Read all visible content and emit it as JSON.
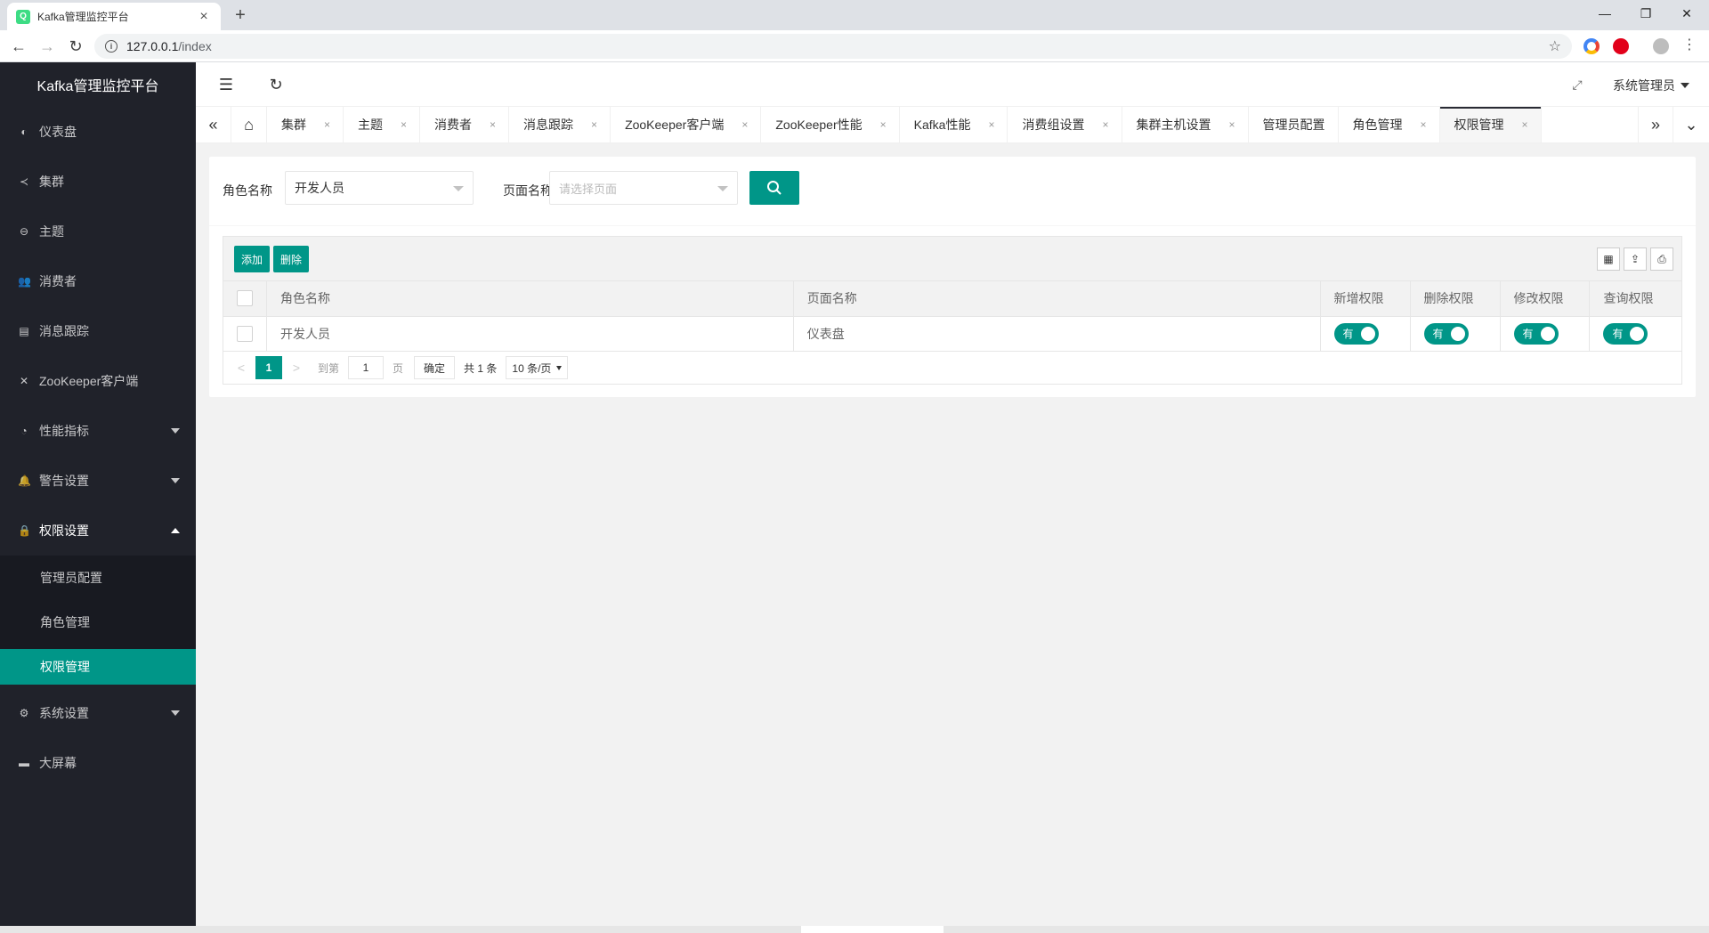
{
  "browser": {
    "tab_title": "Kafka管理监控平台",
    "tab_close": "×",
    "newtab": "+",
    "favicon": "Q",
    "url_host": "127.0.0.1",
    "url_path": "/index",
    "back": "←",
    "forward": "→",
    "reload": "↻",
    "star": "☆",
    "minimize": "—",
    "maximize": "❐",
    "close": "✕"
  },
  "sidebar": {
    "logo": "Kafka管理监控平台",
    "items": [
      {
        "label": "仪表盘",
        "icon": "dashboard-icon",
        "glyph": "◐"
      },
      {
        "label": "集群",
        "icon": "share-icon",
        "glyph": "≺"
      },
      {
        "label": "主题",
        "icon": "topic-icon",
        "glyph": "⊖"
      },
      {
        "label": "消费者",
        "icon": "users-icon",
        "glyph": "👥"
      },
      {
        "label": "消息跟踪",
        "icon": "document-icon",
        "glyph": "▤"
      },
      {
        "label": "ZooKeeper客户端",
        "icon": "tools-icon",
        "glyph": "✕"
      },
      {
        "label": "性能指标",
        "icon": "gauge-icon",
        "glyph": "◔"
      },
      {
        "label": "警告设置",
        "icon": "bell-icon",
        "glyph": "🔔"
      },
      {
        "label": "权限设置",
        "icon": "lock-icon",
        "glyph": "🔒"
      },
      {
        "label": "系统设置",
        "icon": "gear-icon",
        "glyph": "⚙"
      },
      {
        "label": "大屏幕",
        "icon": "monitor-icon",
        "glyph": "▬"
      }
    ],
    "subitems": [
      {
        "label": "管理员配置"
      },
      {
        "label": "角色管理"
      },
      {
        "label": "权限管理"
      }
    ]
  },
  "header": {
    "menu_icon": "☰",
    "refresh_icon": "↻",
    "fullscreen_icon": "⤢",
    "user": "系统管理员"
  },
  "pagetabs": {
    "left_arrow": "«",
    "home": "⌂",
    "right_arrow": "»",
    "down_arrow": "⌄",
    "close": "×",
    "tabs": [
      {
        "label": "集群"
      },
      {
        "label": "主题"
      },
      {
        "label": "消费者"
      },
      {
        "label": "消息跟踪"
      },
      {
        "label": "ZooKeeper客户端"
      },
      {
        "label": "ZooKeeper性能"
      },
      {
        "label": "Kafka性能"
      },
      {
        "label": "消费组设置"
      },
      {
        "label": "集群主机设置"
      },
      {
        "label": "管理员配置"
      },
      {
        "label": "角色管理"
      },
      {
        "label": "权限管理"
      }
    ]
  },
  "search": {
    "role_label": "角色名称",
    "role_value": "开发人员",
    "page_label": "页面名称",
    "page_placeholder": "请选择页面"
  },
  "table": {
    "add_button": "添加",
    "delete_button": "删除",
    "tool_cols": "▦",
    "tool_export": "⇪",
    "tool_print": "⎙",
    "headers": [
      "角色名称",
      "页面名称",
      "新增权限",
      "删除权限",
      "修改权限",
      "查询权限"
    ],
    "rows": [
      {
        "role": "开发人员",
        "page": "仪表盘",
        "add": "有",
        "del": "有",
        "edit": "有",
        "query": "有"
      }
    ]
  },
  "pager": {
    "prev": "<",
    "current": "1",
    "next": ">",
    "goto_label": "到第",
    "goto_value": "1",
    "page_unit": "页",
    "confirm": "确定",
    "total": "共 1 条",
    "page_size": "10 条/页"
  },
  "colors": {
    "primary": "#009688",
    "sidebar_bg": "#20222a"
  }
}
